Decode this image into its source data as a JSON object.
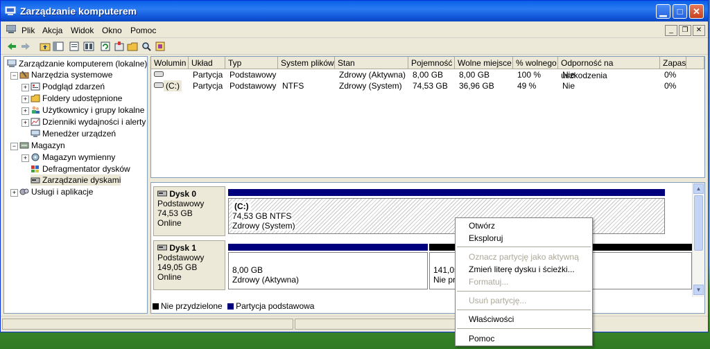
{
  "window": {
    "title": "Zarządzanie komputerem"
  },
  "menu": [
    "Plik",
    "Akcja",
    "Widok",
    "Okno",
    "Pomoc"
  ],
  "toolbar_icons": [
    "back-icon",
    "forward-icon",
    "up-folder-icon",
    "show-tree-icon",
    "properties-icon",
    "refresh-icon",
    "export-icon",
    "open-icon",
    "search-icon",
    "help-icon"
  ],
  "tree": {
    "root": "Zarządzanie komputerem (lokalne)",
    "system_tools": "Narzędzia systemowe",
    "event_viewer": "Podgląd zdarzeń",
    "shared_folders": "Foldery udostępnione",
    "local_users": "Użytkownicy i grupy lokalne",
    "perf_logs": "Dzienniki wydajności i alerty",
    "device_manager": "Menedżer urządzeń",
    "storage": "Magazyn",
    "removable": "Magazyn wymienny",
    "defrag": "Defragmentator dysków",
    "disk_mgmt": "Zarządzanie dyskami",
    "services": "Usługi i aplikacje"
  },
  "volumes": {
    "columns": [
      "Wolumin",
      "Układ",
      "Typ",
      "System plików",
      "Stan",
      "Pojemność",
      "Wolne miejsce",
      "% wolnego",
      "Odporność na uszkodzenia",
      "Zapas"
    ],
    "rows": [
      [
        "",
        "Partycja",
        "Podstawowy",
        "",
        "Zdrowy (Aktywna)",
        "8,00 GB",
        "8,00 GB",
        "100 %",
        "Nie",
        "0%"
      ],
      [
        "(C:)",
        "Partycja",
        "Podstawowy",
        "NTFS",
        "Zdrowy (System)",
        "74,53 GB",
        "36,96 GB",
        "49 %",
        "Nie",
        "0%"
      ]
    ]
  },
  "disks": [
    {
      "name": "Dysk 0",
      "type": "Podstawowy",
      "size": "74,53 GB",
      "status": "Online",
      "partitions": [
        {
          "label": "(C:)",
          "size": "74,53 GB NTFS",
          "status": "Zdrowy (System)"
        }
      ]
    },
    {
      "name": "Dysk 1",
      "type": "Podstawowy",
      "size": "149,05 GB",
      "status": "Online",
      "partitions": [
        {
          "size": "8,00 GB",
          "status": "Zdrowy (Aktywna)"
        },
        {
          "size": "141,05",
          "status": "Nie prz"
        }
      ]
    }
  ],
  "legend": {
    "unallocated": "Nie przydzielone",
    "primary": "Partycja podstawowa"
  },
  "context_menu": {
    "open": "Otwórz",
    "explore": "Eksploruj",
    "mark_active": "Oznacz partycję jako aktywną",
    "change_letter": "Zmień literę dysku i ścieżki...",
    "format": "Formatuj...",
    "delete": "Usuń partycję...",
    "properties": "Właściwości",
    "help": "Pomoc"
  },
  "colors": {
    "primary": "#00007f",
    "unallocated": "#000000",
    "titlebar": "#0a5fe8"
  }
}
